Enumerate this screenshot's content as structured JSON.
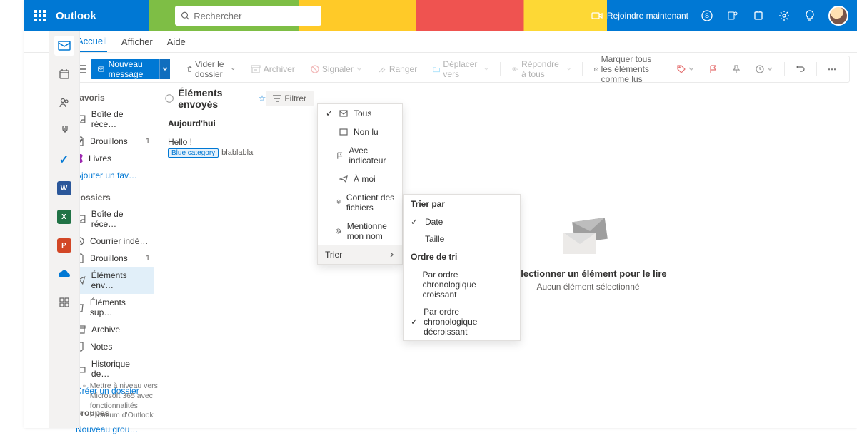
{
  "brand": "Outlook",
  "search": {
    "placeholder": "Rechercher"
  },
  "join_now": "Rejoindre maintenant",
  "tabs": {
    "home": "Accueil",
    "display": "Afficher",
    "help": "Aide"
  },
  "toolbar": {
    "new_message": "Nouveau message",
    "empty_folder": "Vider le dossier",
    "archive": "Archiver",
    "report": "Signaler",
    "tidy": "Ranger",
    "move_to": "Déplacer vers",
    "reply_all": "Répondre à tous",
    "mark_all_read": "Marquer tous les éléments comme lus"
  },
  "sections": {
    "favorites": "Favoris",
    "folders": "Dossiers",
    "groups": "Groupes"
  },
  "favorites": [
    {
      "label": "Boîte de réce…"
    },
    {
      "label": "Brouillons",
      "count": "1"
    },
    {
      "label": "Livres"
    }
  ],
  "add_favorite": "Ajouter un fav…",
  "folders": [
    {
      "label": "Boîte de réce…"
    },
    {
      "label": "Courrier indé…"
    },
    {
      "label": "Brouillons",
      "count": "1"
    },
    {
      "label": "Éléments env…",
      "active": true
    },
    {
      "label": "Éléments sup…"
    },
    {
      "label": "Archive"
    },
    {
      "label": "Notes"
    },
    {
      "label": "Historique de…"
    }
  ],
  "create_folder": "Créer un dossier",
  "new_group": "Nouveau grou…",
  "maillist": {
    "title": "Éléments envoyés",
    "filter": "Filtrer",
    "day": "Aujourd'hui",
    "item": {
      "subject": "Hello !",
      "tag": "Blue category",
      "preview": "blablabla"
    }
  },
  "filter_menu": {
    "all": "Tous",
    "unread": "Non lu",
    "flagged": "Avec indicateur",
    "to_me": "À moi",
    "has_files": "Contient des fichiers",
    "mentions_me": "Mentionne mon nom",
    "sort": "Trier"
  },
  "sort_menu": {
    "sort_by": "Trier par",
    "date": "Date",
    "size": "Taille",
    "order": "Ordre de tri",
    "asc": "Par ordre chronologique croissant",
    "desc": "Par ordre chronologique décroissant"
  },
  "reader": {
    "title": "Sélectionner un élément pour le lire",
    "sub": "Aucun élément sélectionné"
  },
  "upgrade": "Mettre à niveau vers Microsoft 365 avec fonctionnalités Premium d'Outlook"
}
